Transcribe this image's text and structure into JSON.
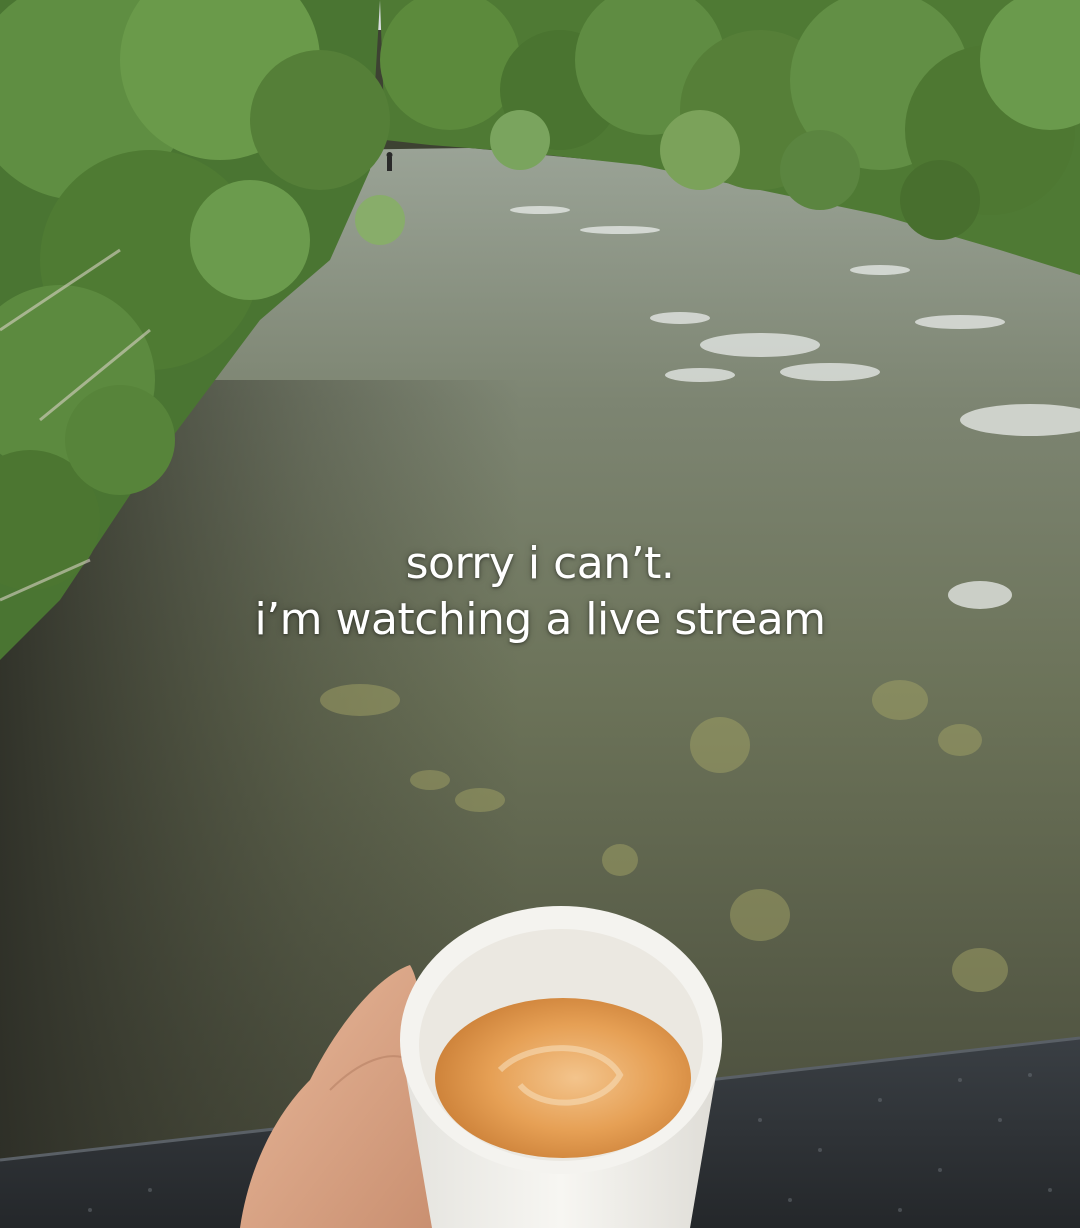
{
  "caption": {
    "line1": "sorry i can’t.",
    "line2": "i’m watching a live stream"
  },
  "colors": {
    "caption_text": "#ffffff",
    "water": "#6f7560",
    "foliage": "#4f7a34",
    "cup": "#f2f1ed",
    "coffee": "#e09a4f",
    "railing": "#2c3034"
  },
  "icons": [
    "river-scene",
    "trees",
    "fisherman",
    "paper-cup",
    "coffee",
    "hand",
    "bridge-railing"
  ]
}
